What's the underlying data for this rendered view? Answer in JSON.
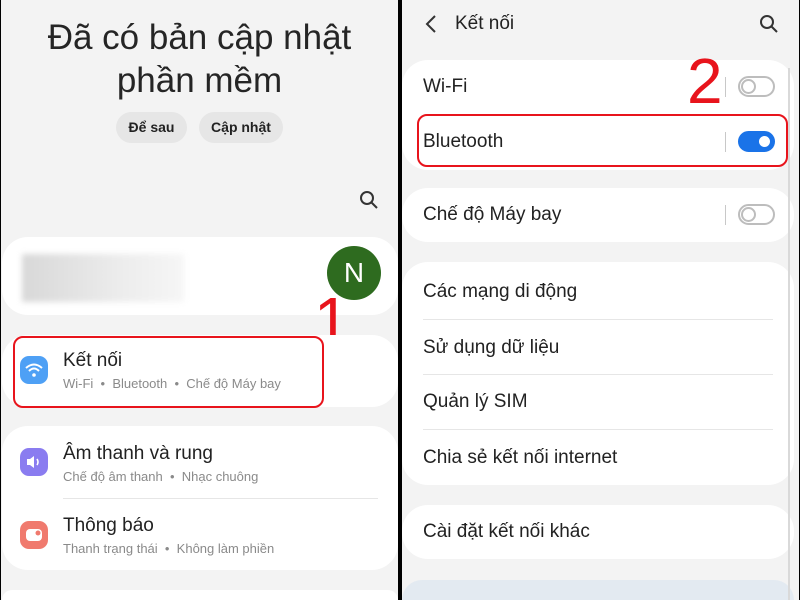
{
  "left": {
    "update_title_line1": "Đã có bản cập nhật",
    "update_title_line2": "phần mềm",
    "later_button": "Để sau",
    "update_button": "Cập nhật",
    "avatar_letter": "N",
    "annotation": "1",
    "items": [
      {
        "label": "Kết nối",
        "sub": "Wi-Fi  •  Bluetooth  •  Chế độ Máy bay",
        "icon": "wifi-icon"
      },
      {
        "label": "Âm thanh và rung",
        "sub": "Chế độ âm thanh  •  Nhạc chuông",
        "icon": "sound-icon"
      },
      {
        "label": "Thông báo",
        "sub": "Thanh trạng thái  •  Không làm phiền",
        "icon": "notification-icon"
      }
    ]
  },
  "right": {
    "header_title": "Kết nối",
    "annotation": "2",
    "toggles": [
      {
        "label": "Wi-Fi",
        "on": false
      },
      {
        "label": "Bluetooth",
        "on": true
      },
      {
        "label": "Chế độ Máy bay",
        "on": false
      }
    ],
    "items": [
      "Các mạng di động",
      "Sử dụng dữ liệu",
      "Quản lý SIM",
      "Chia sẻ kết nối internet"
    ],
    "more": "Cài đặt kết nối khác"
  },
  "colors": {
    "annotation": "#e8141c",
    "toggle_on": "#1a73e8",
    "avatar": "#2e6b1f",
    "wifi_icon": "#4ea0f5",
    "sound_icon": "#8a7cf0",
    "notification_icon": "#f07a6e"
  }
}
